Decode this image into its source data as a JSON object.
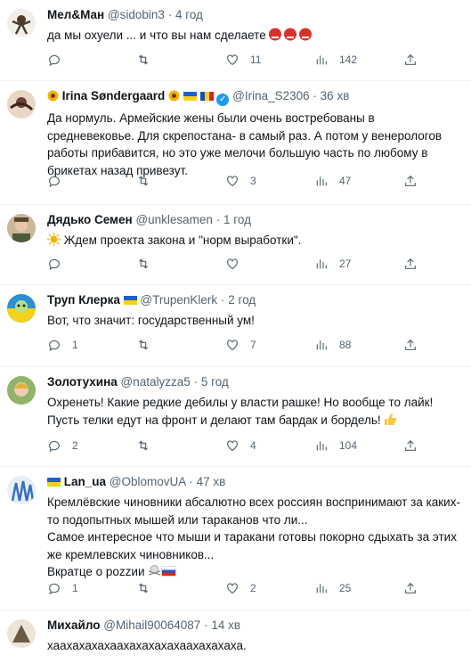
{
  "tweets": [
    {
      "name": "Мел&Ман",
      "handle": "@sidobin3",
      "sep": "·",
      "time": "4 год",
      "text": "да мы охуели ... и что вы нам сделаете",
      "reply": "",
      "retweet": "",
      "like": "11",
      "views": "142"
    },
    {
      "name": "Irina Søndergaard",
      "handle": "@Irina_S2306",
      "sep": "·",
      "time": "36 хв",
      "text": "Да нормуль. Армейские жены были очень востребованы в средневековье. Для скрепостана- в самый раз. А потом у венерологов работы прибавится, но это уже мелочи большую часть по любому в брикетах назад привезут.",
      "reply": "",
      "retweet": "",
      "like": "3",
      "views": "47"
    },
    {
      "name": "Дядько Семен",
      "handle": "@unklesamen",
      "sep": "·",
      "time": "1 год",
      "text": "Ждем проекта закона и \"норм выработки\".",
      "reply": "",
      "retweet": "",
      "like": "",
      "views": "27"
    },
    {
      "name": "Труп Клерка",
      "handle": "@TrupenKlerk",
      "sep": "·",
      "time": "2 год",
      "text": "Вот, что значит: государственный ум!",
      "reply": "1",
      "retweet": "",
      "like": "7",
      "views": "88"
    },
    {
      "name": "Золотухина",
      "handle": "@natalyzza5",
      "sep": "·",
      "time": "5 год",
      "text": "Охренеть! Какие редкие дебилы у власти рашке! Но вообще то лайк! Пусть телки едут на фронт и делают там бардак и бордель!",
      "reply": "2",
      "retweet": "",
      "like": "4",
      "views": "104"
    },
    {
      "name": "Lan_ua",
      "handle": "@OblomovUA",
      "sep": "·",
      "time": "47 хв",
      "text1": "Кремлёвские чиновники абсалютно всех россиян воспринимают за каких-то подопытных мышей или тараканов что ли...",
      "text2": "Самое интересное что мыши и  таракани готовы покорно сдыхать за этих же кремлевских чиновников...",
      "text3": "Вкратце о роzzии",
      "reply": "1",
      "retweet": "",
      "like": "2",
      "views": "25"
    },
    {
      "name": "Михайло",
      "handle": "@Mihail90064087",
      "sep": "·",
      "time": "14 хв",
      "text": "хаахахахахаахахахахахаахахахаха."
    }
  ]
}
